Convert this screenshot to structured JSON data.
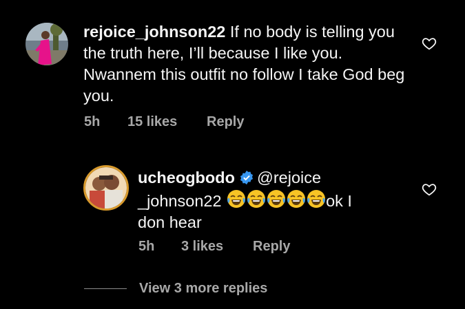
{
  "comments": [
    {
      "username": "rejoice_johnson22",
      "text": " If no body is telling you the truth here, I’ll because I like you. Nwannem this outfit no follow I take God beg you.",
      "time": "5h",
      "likes": "15 likes",
      "reply_label": "Reply",
      "icon": "heart-outline-icon"
    }
  ],
  "reply": {
    "username": "ucheogbodo",
    "verified": true,
    "mention": "@rejoice",
    "mention2": "_johnson22",
    "emoji_count": 5,
    "text_after": "ok I",
    "text_line3": "don hear",
    "time": "5h",
    "likes": "3 likes",
    "reply_label": "Reply",
    "icon": "heart-outline-icon"
  },
  "view_more": "View 3 more replies",
  "colors": {
    "background": "#000000",
    "text": "#f5f5f5",
    "meta": "#a8a8a8",
    "verified": "#3897f0"
  }
}
